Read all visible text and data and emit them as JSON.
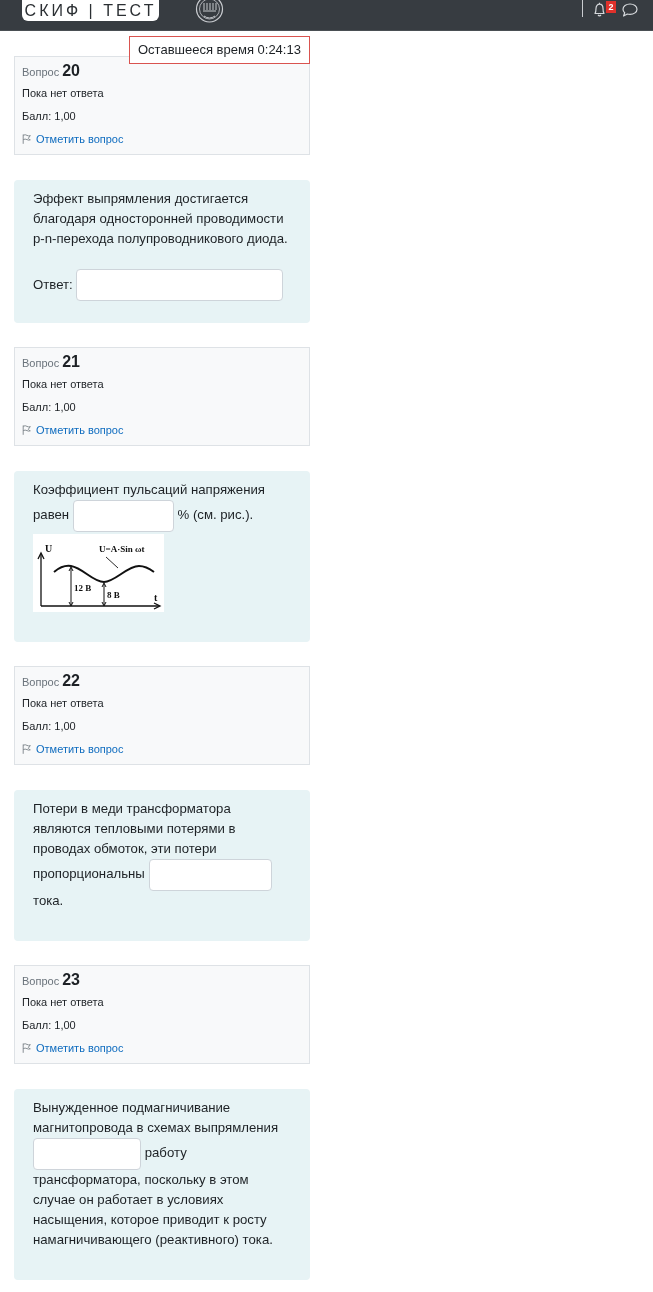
{
  "header": {
    "logo": "СКИФ | ТЕСТ",
    "notification_count": "2"
  },
  "timer": {
    "text": "Оставшееся время 0:24:13"
  },
  "questions": [
    {
      "info": {
        "label": "Вопрос",
        "number": "20",
        "status": "Пока нет ответа",
        "grade": "Балл: 1,00",
        "flag_link": "Отметить вопрос"
      },
      "content": [
        {
          "kind": "paragraph",
          "parts": [
            {
              "kind": "text",
              "text": "Эффект выпрямления достигается благодаря односторонней проводимости p-n-перехода полупроводникового диода."
            }
          ]
        },
        {
          "kind": "answer",
          "label": "Ответ:"
        }
      ]
    },
    {
      "info": {
        "label": "Вопрос",
        "number": "21",
        "status": "Пока нет ответа",
        "grade": "Балл: 1,00",
        "flag_link": "Отметить вопрос"
      },
      "content": [
        {
          "kind": "paragraph",
          "parts": [
            {
              "kind": "text",
              "text": "Коэффициент пульсаций напряжения"
            },
            {
              "kind": "text",
              "text": "равен"
            },
            {
              "kind": "blank"
            },
            {
              "kind": "text",
              "text": "% (см. рис.)."
            }
          ]
        },
        {
          "kind": "figure",
          "labels": {
            "y_axis": "U",
            "x_axis": "t",
            "formula": "U=A·Sin ωt",
            "peak": "12 В",
            "trough": "8 В"
          }
        }
      ]
    },
    {
      "info": {
        "label": "Вопрос",
        "number": "22",
        "status": "Пока нет ответа",
        "grade": "Балл: 1,00",
        "flag_link": "Отметить вопрос"
      },
      "content": [
        {
          "kind": "paragraph",
          "parts": [
            {
              "kind": "text",
              "text": "Потери в меди трансформатора являются тепловыми потерями в проводах обмоток, эти потери"
            },
            {
              "kind": "text",
              "text": "пропорциональны"
            },
            {
              "kind": "blank"
            },
            {
              "kind": "text",
              "text": "тока."
            }
          ]
        }
      ]
    },
    {
      "info": {
        "label": "Вопрос",
        "number": "23",
        "status": "Пока нет ответа",
        "grade": "Балл: 1,00",
        "flag_link": "Отметить вопрос"
      },
      "content": [
        {
          "kind": "paragraph",
          "parts": [
            {
              "kind": "text",
              "text": "Вынужденное подмагничивание магнитопровода в схемах выпрямления"
            },
            {
              "kind": "blank"
            },
            {
              "kind": "text",
              "text": "работу"
            },
            {
              "kind": "text",
              "text": "трансформатора, поскольку в этом случае он работает в условиях насыщения, которое приводит к росту намагничивающего (реактивного) тока."
            }
          ]
        }
      ]
    }
  ]
}
